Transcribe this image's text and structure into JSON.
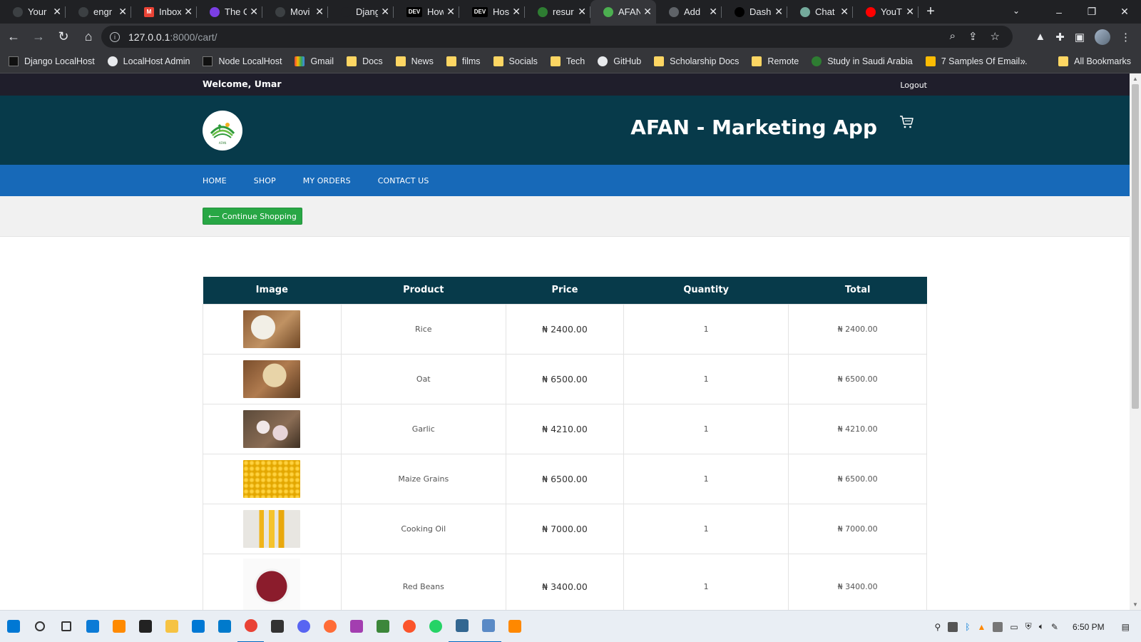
{
  "browser": {
    "tabs": [
      {
        "title": "Your",
        "color": "#3c4043"
      },
      {
        "title": "engr",
        "color": "#3c4043"
      },
      {
        "title": "Inbox",
        "color": "#ea4335"
      },
      {
        "title": "The C",
        "color": "#7b3fe4"
      },
      {
        "title": "Movi",
        "color": "#3c4043"
      },
      {
        "title": "Djang",
        "color": "#202124"
      },
      {
        "title": "How",
        "color": "#000000"
      },
      {
        "title": "Host",
        "color": "#000000"
      },
      {
        "title": "resur",
        "color": "#2e7d32"
      },
      {
        "title": "AFAN",
        "color": "#4caf50"
      },
      {
        "title": "Add",
        "color": "#5f6368"
      },
      {
        "title": "Dash",
        "color": "#000000"
      },
      {
        "title": "Chat",
        "color": "#74aa9c"
      },
      {
        "title": "YouT",
        "color": "#ff0000"
      }
    ],
    "tab_badges": [
      "",
      "",
      "M",
      "",
      "",
      "",
      "DEV",
      "DEV",
      "",
      "",
      "",
      "",
      "",
      ""
    ],
    "active_tab_index": 9,
    "address": {
      "host": "127.0.0.1",
      "path": ":8000/cart/"
    },
    "bookmarks": [
      {
        "label": "Django LocalHost",
        "icon": "django-icon"
      },
      {
        "label": "LocalHost Admin",
        "icon": "globe-icon"
      },
      {
        "label": "Node LocalHost",
        "icon": "node-icon"
      },
      {
        "label": "Gmail",
        "icon": "gmail-icon"
      },
      {
        "label": "Docs",
        "icon": "folder-icon"
      },
      {
        "label": "News",
        "icon": "folder-icon"
      },
      {
        "label": "films",
        "icon": "folder-icon"
      },
      {
        "label": "Socials",
        "icon": "folder-icon"
      },
      {
        "label": "Tech",
        "icon": "folder-icon"
      },
      {
        "label": "GitHub",
        "icon": "github-icon"
      },
      {
        "label": "Scholarship Docs",
        "icon": "folder-icon"
      },
      {
        "label": "Remote",
        "icon": "folder-icon"
      },
      {
        "label": "Study in Saudi Arabia",
        "icon": "study-icon"
      },
      {
        "label": "7 Samples Of Email...",
        "icon": "mail7-icon"
      }
    ],
    "bookmarks_more": "»",
    "all_bookmarks": "All Bookmarks"
  },
  "page": {
    "welcome": "Welcome, Umar",
    "logout": "Logout",
    "brand_title": "AFAN - Marketing App",
    "logo_text": "AFAN",
    "nav": [
      "HOME",
      "SHOP",
      "MY ORDERS",
      "CONTACT US"
    ],
    "continue_shopping": "⟵ Continue Shopping",
    "table_headers": [
      "Image",
      "Product",
      "Price",
      "Quantity",
      "Total"
    ],
    "cart_items": [
      {
        "product": "Rice",
        "price": "₦ 2400.00",
        "quantity": "1",
        "total": "₦ 2400.00",
        "image": "rice"
      },
      {
        "product": "Oat",
        "price": "₦ 6500.00",
        "quantity": "1",
        "total": "₦ 6500.00",
        "image": "oat"
      },
      {
        "product": "Garlic",
        "price": "₦ 4210.00",
        "quantity": "1",
        "total": "₦ 4210.00",
        "image": "garlic"
      },
      {
        "product": "Maize Grains",
        "price": "₦ 6500.00",
        "quantity": "1",
        "total": "₦ 6500.00",
        "image": "maize"
      },
      {
        "product": "Cooking Oil",
        "price": "₦ 7000.00",
        "quantity": "1",
        "total": "₦ 7000.00",
        "image": "oil"
      },
      {
        "product": "Red Beans",
        "price": "₦ 3400.00",
        "quantity": "1",
        "total": "₦ 3400.00",
        "image": "beans"
      }
    ],
    "colors": {
      "topbar": "#1f1e2b",
      "brandbar": "#073a4a",
      "nav": "#1769b8",
      "button": "#28a745"
    }
  },
  "taskbar": {
    "apps": [
      {
        "name": "windows-start-icon",
        "color": "#0078d4"
      },
      {
        "name": "search-icon",
        "color": "#333333"
      },
      {
        "name": "task-view-icon",
        "color": "#333333"
      },
      {
        "name": "edge-icon",
        "color": "#0c7bd6"
      },
      {
        "name": "sublime-icon",
        "color": "#ff8a00"
      },
      {
        "name": "store-icon",
        "color": "#222222"
      },
      {
        "name": "file-explorer-icon",
        "color": "#f6c343"
      },
      {
        "name": "mail-icon",
        "color": "#0078d4"
      },
      {
        "name": "vscode-icon",
        "color": "#007acc"
      },
      {
        "name": "chrome-icon",
        "color": "#e94235"
      },
      {
        "name": "sticky-notes-icon",
        "color": "#333333"
      },
      {
        "name": "discord-icon",
        "color": "#5865f2"
      },
      {
        "name": "postman-icon",
        "color": "#ff6c37"
      },
      {
        "name": "mongodb-compass-icon",
        "color": "#a33eb0"
      },
      {
        "name": "node-icon",
        "color": "#3c873a"
      },
      {
        "name": "brave-icon",
        "color": "#fb542b"
      },
      {
        "name": "whatsapp-icon",
        "color": "#25d366"
      },
      {
        "name": "postgres-icon",
        "color": "#336791"
      },
      {
        "name": "photos-icon",
        "color": "#5a8ac6"
      },
      {
        "name": "vlc-icon",
        "color": "#ff8800"
      }
    ],
    "running": [
      9,
      17,
      18
    ],
    "clock": "6:50 PM"
  }
}
